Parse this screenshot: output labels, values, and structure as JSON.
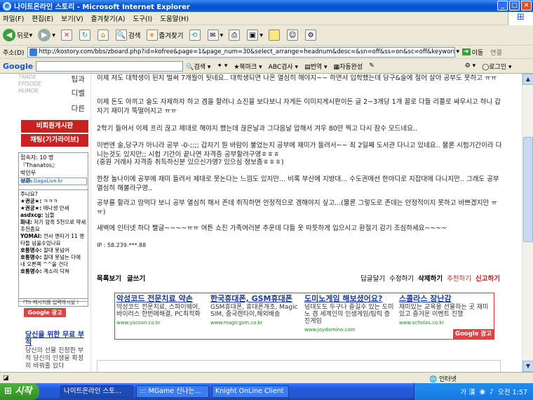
{
  "window": {
    "title": "나이트온라인 스토리 - Microsoft Internet Explorer"
  },
  "menu": [
    "파일(F)",
    "편집(E)",
    "보기(V)",
    "즐겨찾기(A)",
    "도구(I)",
    "도움말(H)"
  ],
  "toolbar": {
    "back": "뒤로",
    "search": "검색",
    "favorites": "즐겨찾기"
  },
  "address": {
    "label": "주소(D)",
    "url": "http://kostory.com/bbs/zboard.php?id=kofree&page=1&page_num=30&select_arrange=headnum&desc=&sn=off&ss=on&sc=off&keyword=&no=929",
    "go": "이동",
    "links": "연결"
  },
  "google_toolbar": {
    "logo": "Google",
    "search": "검색",
    "bookmark": "북마크",
    "check": "검사",
    "translate": "번역",
    "autofill": "자동완성",
    "login": "로그인"
  },
  "sidebar": {
    "menu_items": [
      "TRADE",
      "EPISODE",
      "HUMOR"
    ],
    "links": [
      "팁과",
      "디벨",
      "다른"
    ],
    "buttons": [
      "비회원게시판",
      "채팅(가가라이브)"
    ],
    "chat": {
      "count": "접속자: 10 명",
      "users": [
        "『Thanatos』",
        "박민우",
        "상봉"
      ],
      "input": "www.GagaLive.kr",
      "messages": [
        {
          "nick": "",
          "text": "주나요?"
        },
        {
          "nick": "★권궁★:",
          "text": "ㅋㅋㅋ"
        },
        {
          "nick": "★권궁★:",
          "text": "애나생 만세"
        },
        {
          "nick": "asdxcg:",
          "text": "님들"
        },
        {
          "nick": "화내:",
          "text": "저기 암흑 5천으로 약세추천좀요"
        },
        {
          "nick": "YOMAI:",
          "text": "전사 멘타가 11 멘타들 넘을수있나요"
        },
        {
          "nick": "호통명수:",
          "text": "잘대 못넘어"
        },
        {
          "nick": "호통명수:",
          "text": "잘대 못넘는 다에 내 오른쪽 ^^을 건다"
        },
        {
          "nick": "호통명수:",
          "text": "계소리 닥쳐"
        }
      ],
      "msg_input": "『Th 메시지를 입력하시실 !"
    },
    "google_ad": "Google 광고",
    "side_ad": {
      "title": "당신을 위한 무료 부적",
      "desc": "당신의 선물 진정한 부적 당신의 인생을 확정히 바꿔줄 있다"
    }
  },
  "post": {
    "lines": [
      "이제 저도 대학생이 된지 벌써 7개월이 됫네요.. 대학생되면 나온 열심히 해야지~~ 하면서 입학했는데 당구&술에 절어 살아 공부도 못하고 ㅠㅠ",
      "이제 돈도 아끼고 술도 자제하자 하고 겜을 할려니 쇼진을 보다보니 자게든 이미지게시판이든 글 2~3개당 1개 꼴로 다들 리플로 싸우시고 하니 갑자기 재미가 뚝떨어지고 ㅠㅠ",
      "2학기 들어서 이제 프리 끊고 제대로 해야지 했는데 끊은날과 그다음날 압해서 겨우 80만 찍고 다시 잠수 모드네요..",
      "이번엔 술,당구가 아니라 공부 -0-;;;; 갑자기 뭔 바람이 불었는지 공부에 재미가 들려서~~ 죄 2일째 도서관 다니고 있네요.. 물론 시험기간이라 다니는것도 있지만;; 시험 기간이 끝나면 자격증 공부할려구영ㅎㅎㅎ",
      "(중원 거래사 자격증 취득하신분 있으신가영? 있으심 정보좀ㅎㅎㅎ)",
      "한창 놀나이에 공부에 재미 들려서 제대로 못논다는 느낌도 있지만... 비록 부산에 지방대... 수도권에선 한마디로 지잡대에 다니지만.. 그래도 공부 열심히 해볼라구영..",
      "공부를 할라고 맘먹다 보니 공부 열심히 해서 존데 취직하면 안정적으로 겜해야지 싶고...(물론 그렇도로 존데는 안정적이지 못하고 바쁘겠지만 ㅠㅠ)",
      "새벽에 인터넷 하다 빨글~~~~ㅠㅠ 여튼 쇼진 가족여러분 추운데 다들 옷 따뜻하게 입으시고 환절기 감기 조심하세요~~~~",
      "IP : 58.239.***.88"
    ]
  },
  "post_nav": {
    "list": "목록보기",
    "write": "글쓰기",
    "reply": "답글달기",
    "edit": "수정하기",
    "delete": "삭제하기",
    "recommend": "추천하기",
    "report": "신고하기"
  },
  "ads": [
    {
      "title": "악성코드 전문치료 약손",
      "desc": "악성코드 전문치료, 스파이웨어, 바이러스 한번에해결, PC최적화",
      "url": "www.yacson.co.kr"
    },
    {
      "title": "한국휴대폰, GSM휴대폰",
      "desc": "GSM휴대폰, 휴대폰개조, Magic SIM, 중국렌타이,해외배송",
      "url": "www.magicgsm.co.kr"
    },
    {
      "title": "도미노게임 해보셨어요?",
      "desc": "넘대도도 두구나 즐길수 있는 도미노 겜 세계인의 인생게임/팀릭 증진게임",
      "url": "www.joydomino.com"
    },
    {
      "title": "스콜라스 장난감",
      "desc": "재미있는 교육용 선물하는 곳 재미있고 즐거운 이벤트 진행",
      "url": "www.scholas.co.kr"
    }
  ],
  "ads_badge": "Google 광고",
  "status": {
    "zone": "인터넷"
  },
  "taskbar": {
    "start": "시작",
    "tasks": [
      "나이트온라인 스토...",
      "::: MGame 신나는...",
      "Knight OnLine Client"
    ],
    "lang": "가 漢",
    "clock": "오전 1:57"
  }
}
